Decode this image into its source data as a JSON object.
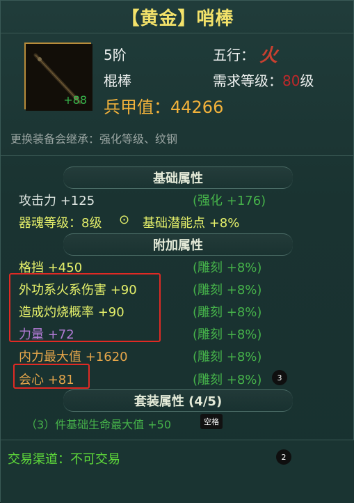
{
  "title": "【黄金】哨棒",
  "item": {
    "plus": "+88"
  },
  "info": {
    "tier": "5阶",
    "type": "棍棒",
    "wuxing_label": "五行：",
    "wuxing_value": "火",
    "req_prefix": "需求等级：",
    "req_level": "80",
    "req_suffix": "级",
    "power": "兵甲值：44266"
  },
  "inherit_note": "更换装备会继承：强化等级、纹钢",
  "sections": {
    "base": "基础属性",
    "extra": "附加属性",
    "set": "套装属性 (4/5)"
  },
  "base_attrs": {
    "attack": "攻击力  +125",
    "attack_bonus": "(强化 +176)",
    "soul_level": "器魂等级：8级",
    "soul_icon": "⊙",
    "potential": "基础潜能点  +8%"
  },
  "extra_attrs": [
    {
      "name": "格挡  +450",
      "bonus": "(雕刻 +8%)"
    },
    {
      "name": "外功系火系伤害  +90",
      "bonus": "(雕刻 +8%)"
    },
    {
      "name": "造成灼烧概率  +90",
      "bonus": "(雕刻 +8%)"
    },
    {
      "name": "力量  +72",
      "bonus": "(雕刻 +8%)"
    },
    {
      "name": "内力最大值  +1620",
      "bonus": "(雕刻 +8%)"
    },
    {
      "name": "会心  +81",
      "bonus": "(雕刻 +8%)"
    }
  ],
  "set_line": "（3）件基础生命最大值  +50",
  "tooltip": "空格",
  "trade": "交易渠道：不可交易",
  "badges": {
    "b1": "3",
    "b2": "2"
  },
  "colors": {
    "title": "#f3e26a",
    "gold_border": "#b88c3a",
    "highlight_box": "#e02a24"
  }
}
